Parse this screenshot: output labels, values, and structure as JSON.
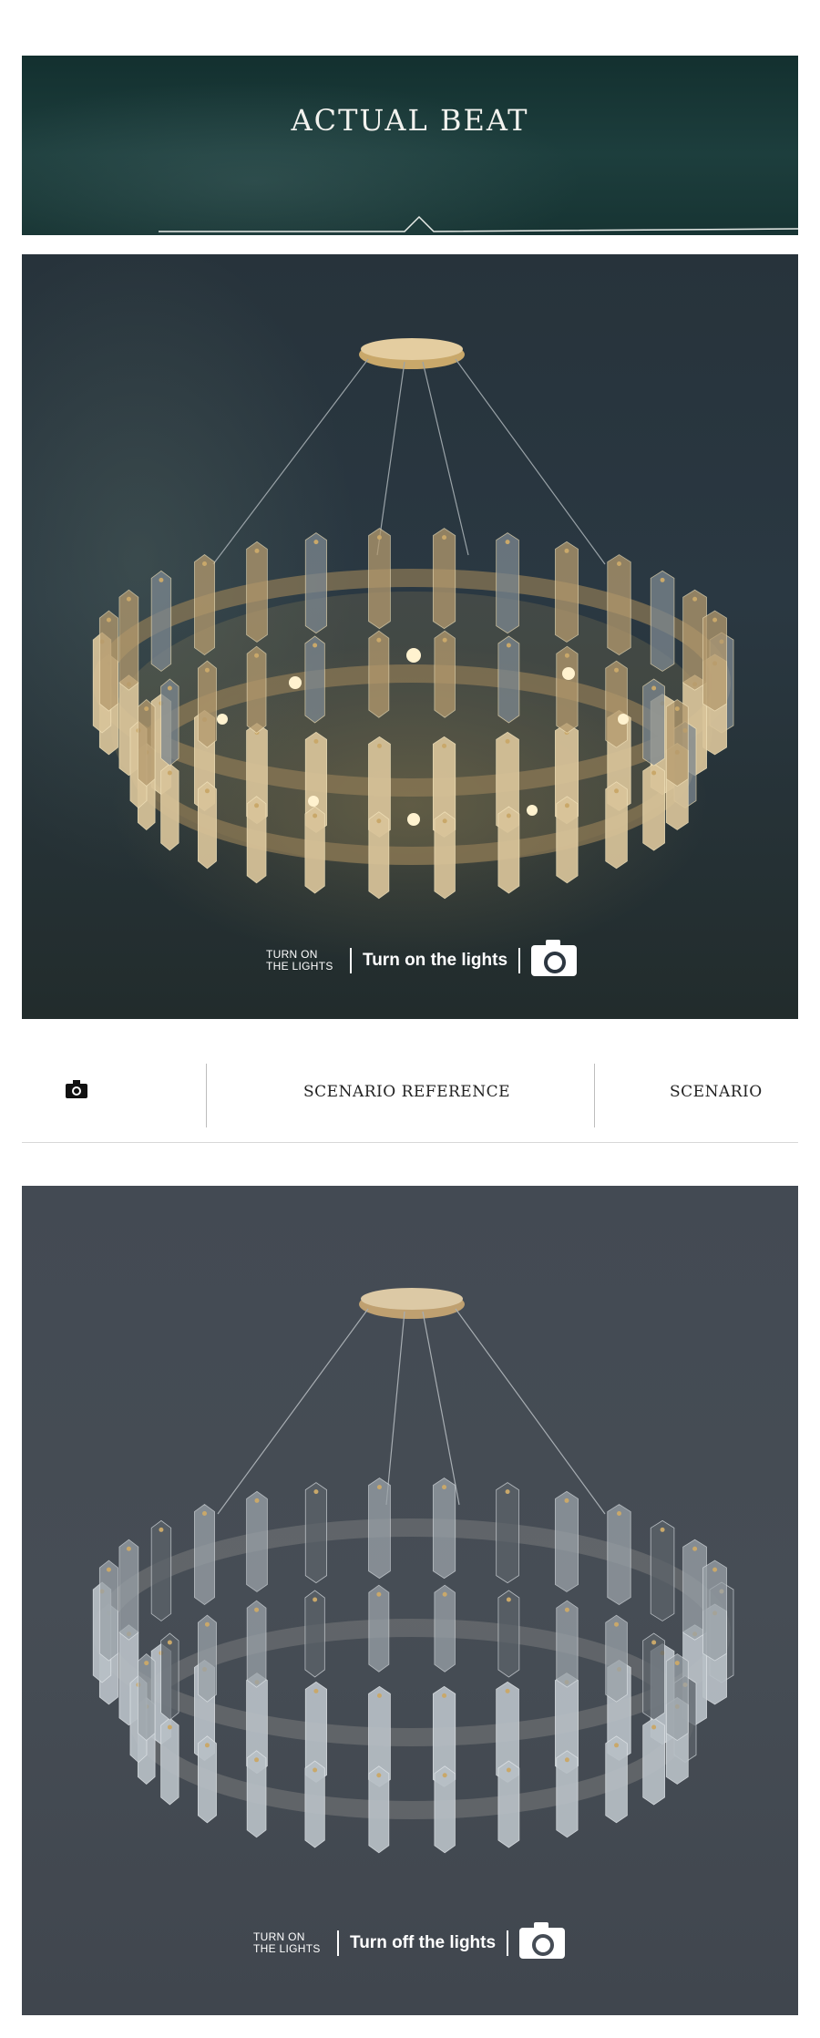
{
  "banner": {
    "title": "ACTUAL BEAT"
  },
  "lights_on": {
    "small_caption_line1": "TURN ON",
    "small_caption_line2": "THE LIGHTS",
    "main_caption": "Turn on the lights",
    "icon": "camera-icon"
  },
  "scenario_bar": {
    "icon": "camera-icon",
    "reference_label": "SCENARIO REFERENCE",
    "scenario_label": "SCENARIO"
  },
  "lights_off": {
    "small_caption_line1": "TURN ON",
    "small_caption_line2": "THE LIGHTS",
    "main_caption": "Turn off the lights",
    "icon": "camera-icon"
  },
  "colors": {
    "banner_bg": "#1d3e3d",
    "on_bg": "#2a3842",
    "off_bg": "#464d55",
    "crystal_warm": "#d9c49a",
    "crystal_cool": "#b8c0c6",
    "gold": "#c9a86a"
  }
}
